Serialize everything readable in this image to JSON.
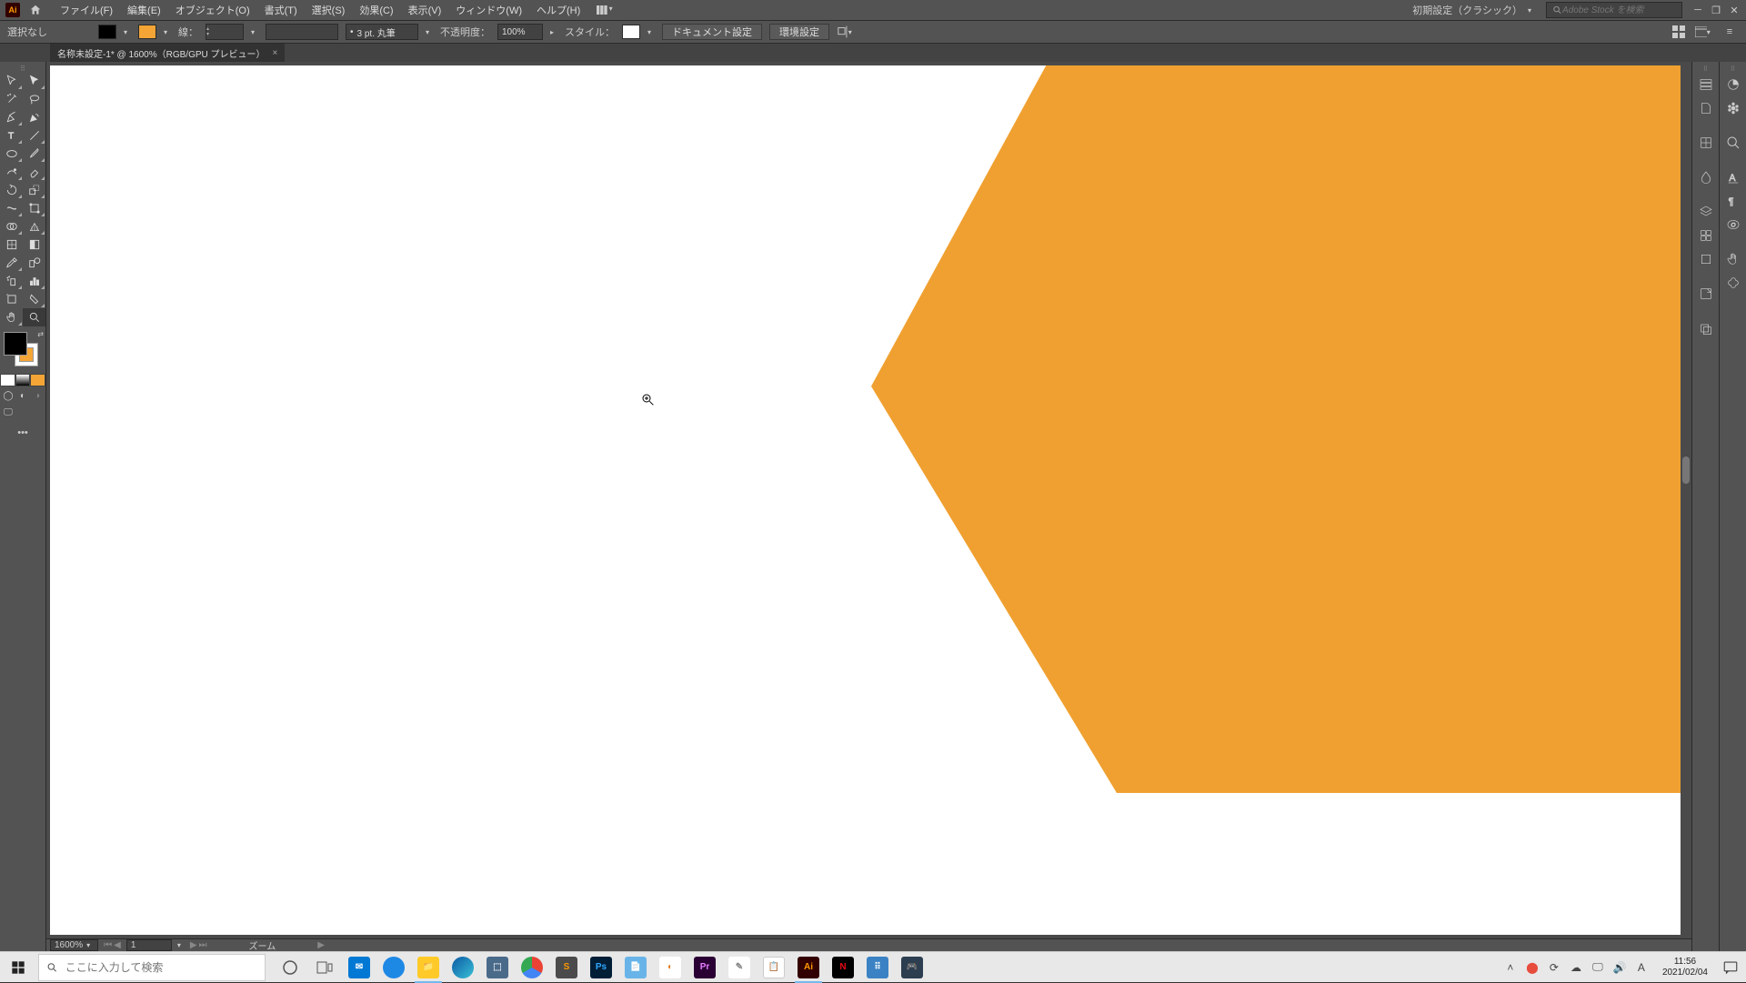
{
  "menubar": {
    "items": [
      "ファイル(F)",
      "編集(E)",
      "オブジェクト(O)",
      "書式(T)",
      "選択(S)",
      "効果(C)",
      "表示(V)",
      "ウィンドウ(W)",
      "ヘルプ(H)"
    ],
    "workspace": "初期設定（クラシック）",
    "search_placeholder": "Adobe Stock を検索"
  },
  "controlbar": {
    "selection": "選択なし",
    "stroke_label": "線：",
    "stroke_weight": "",
    "profile": "3 pt. 丸筆",
    "opacity_label": "不透明度：",
    "opacity": "100%",
    "style_label": "スタイル：",
    "doc_setup": "ドキュメント設定",
    "prefs": "環境設定"
  },
  "document": {
    "tab_title": "名称未設定-1* @ 1600%（RGB/GPU プレビュー）"
  },
  "statusbar": {
    "zoom": "1600%",
    "artboard": "1",
    "tool": "ズーム"
  },
  "taskbar": {
    "search_placeholder": "ここに入力して検索",
    "time": "11:56",
    "date": "2021/02/04",
    "ime": "A"
  },
  "colors": {
    "canvas_shape": "#f0a030",
    "fill": "#000000",
    "stroke": "#f4a536"
  }
}
